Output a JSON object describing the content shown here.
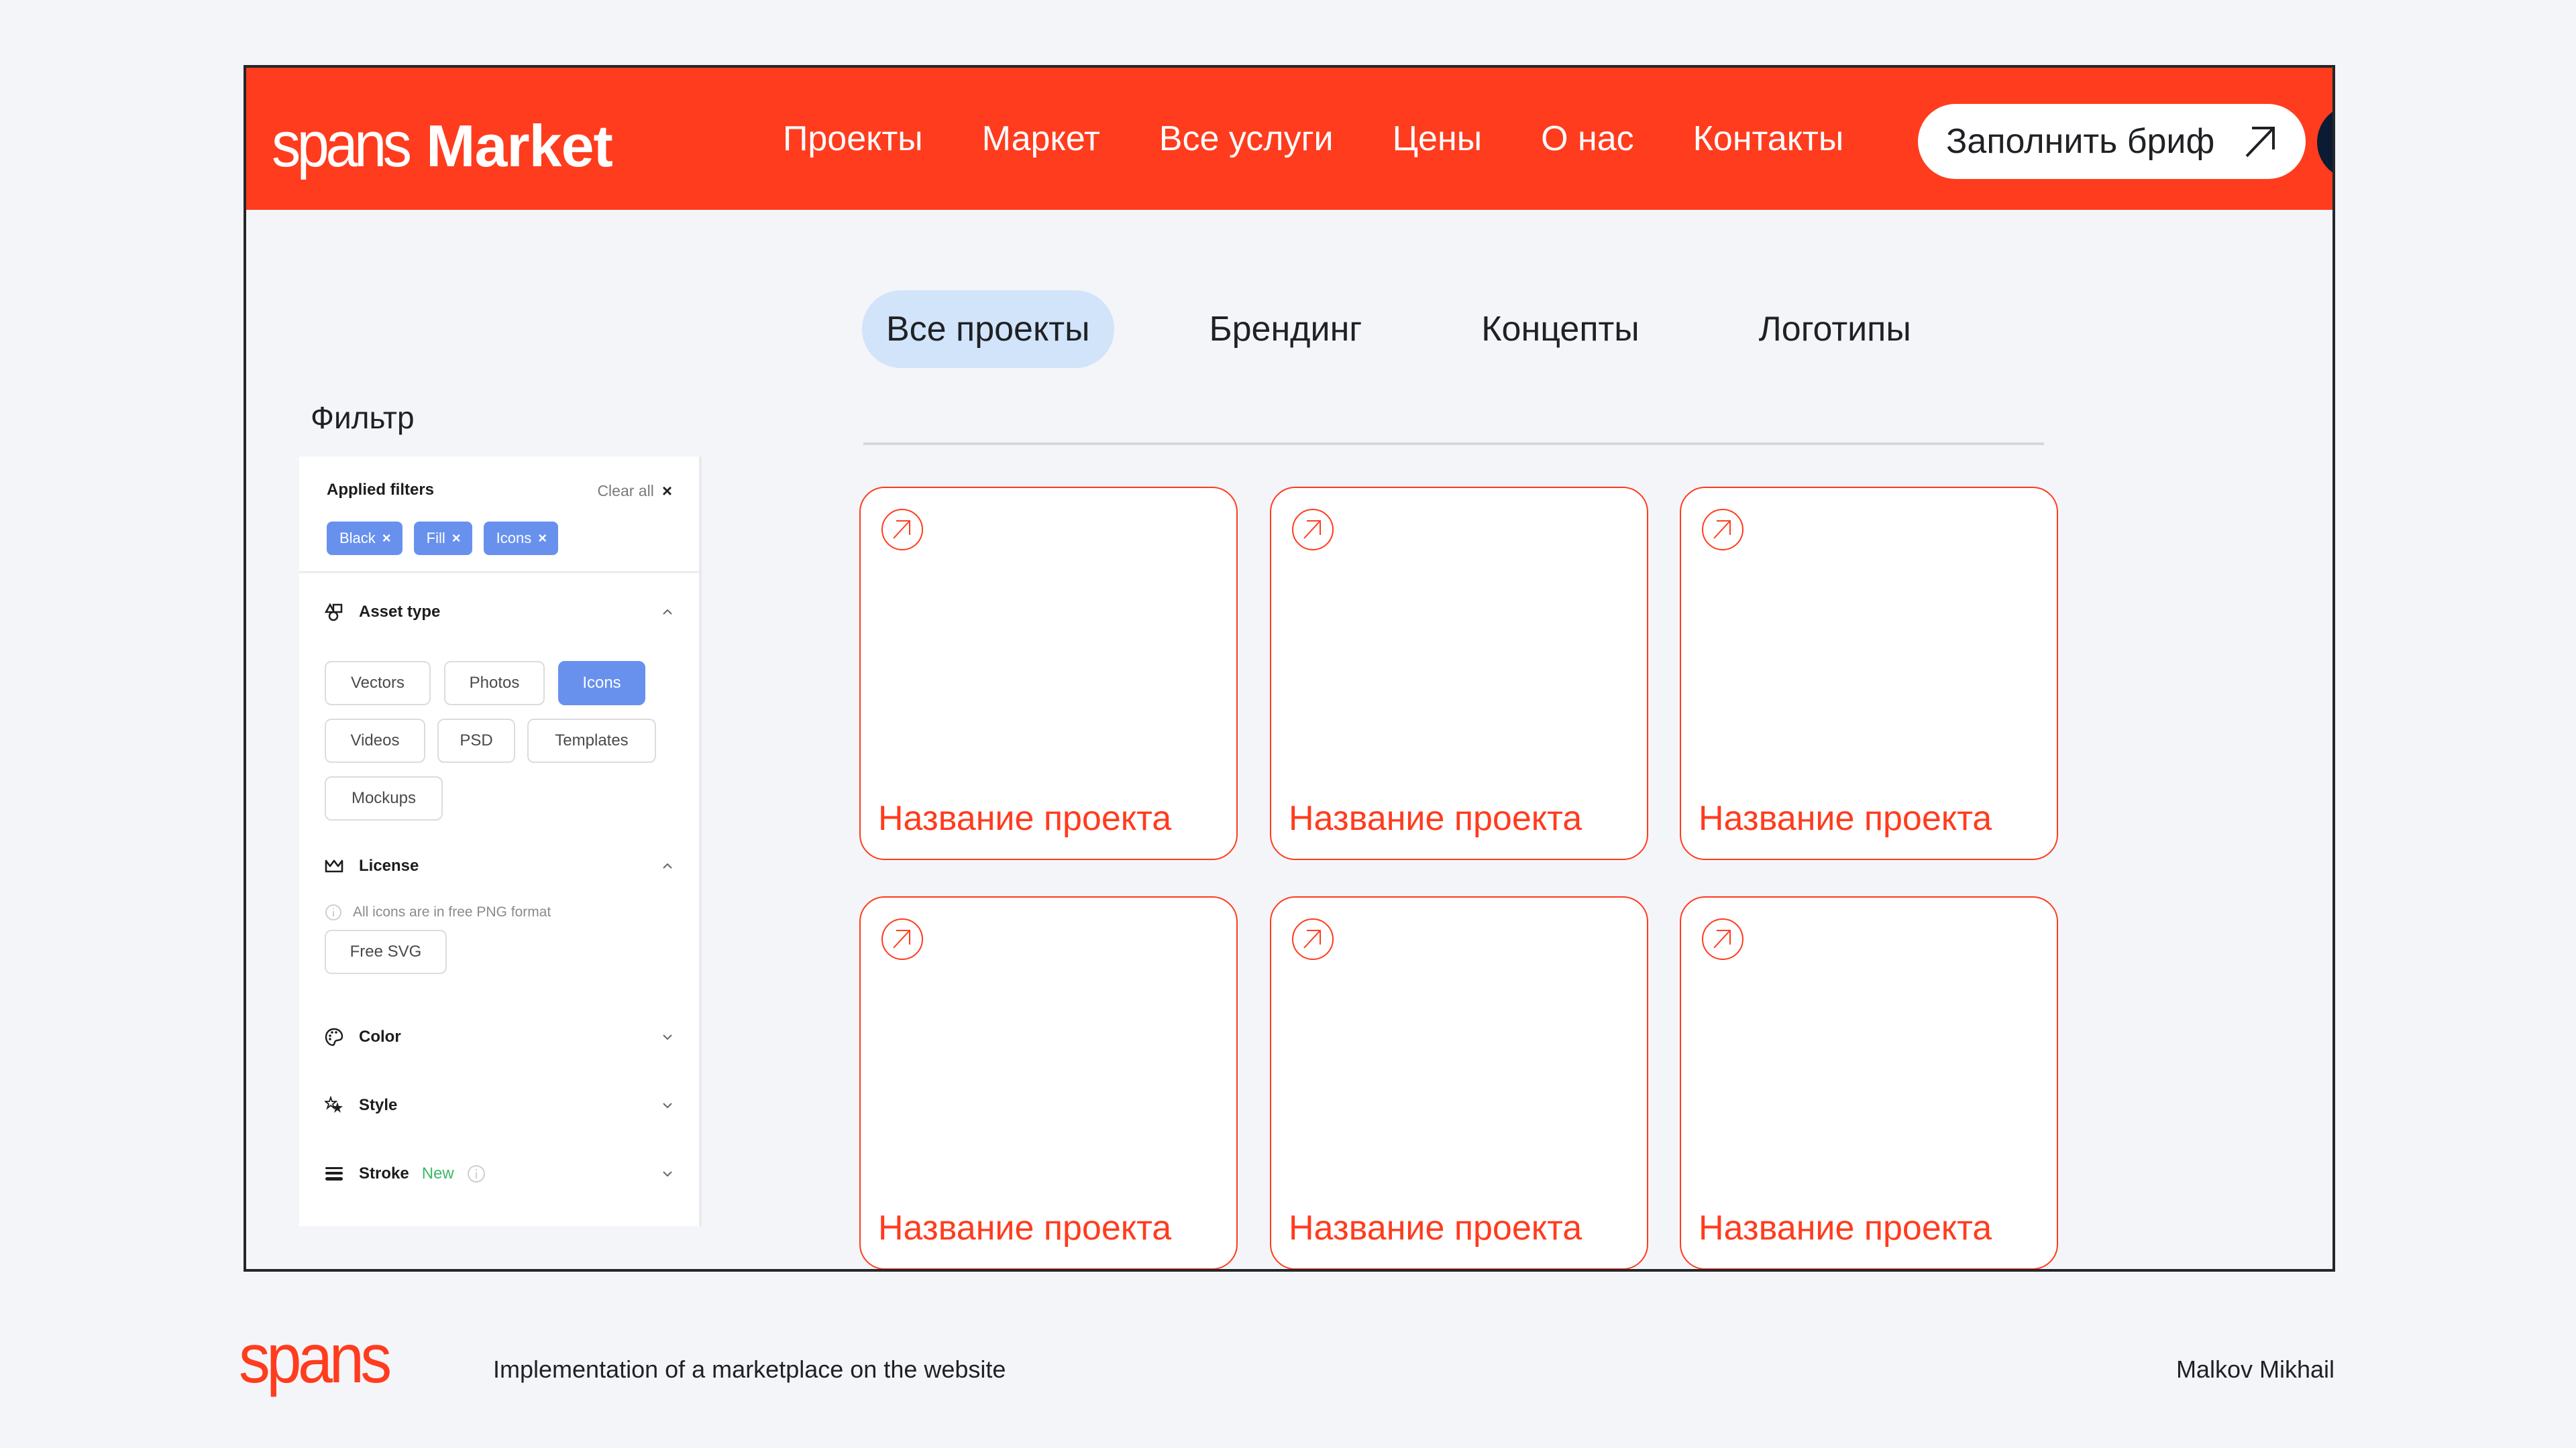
{
  "header": {
    "logo_word": "spans",
    "logo_product": "Market",
    "nav": [
      "Проекты",
      "Маркет",
      "Все услуги",
      "Цены",
      "О нас",
      "Контакты"
    ],
    "cta_label": "Заполнить бриф",
    "cta_icon": "arrow-up-right-icon"
  },
  "tabs": [
    {
      "label": "Все проекты",
      "active": true
    },
    {
      "label": "Брендинг",
      "active": false
    },
    {
      "label": "Концепты",
      "active": false
    },
    {
      "label": "Логотипы",
      "active": false
    }
  ],
  "filter": {
    "title": "Фильтр",
    "applied": {
      "title": "Applied filters",
      "clear_all": "Clear all",
      "chips": [
        "Black",
        "Fill",
        "Icons"
      ]
    },
    "sections": {
      "asset_type": {
        "title": "Asset type",
        "expanded": true,
        "options": [
          "Vectors",
          "Photos",
          "Icons",
          "Videos",
          "PSD",
          "Templates",
          "Mockups"
        ],
        "selected": "Icons"
      },
      "license": {
        "title": "License",
        "expanded": true,
        "note": "All icons are in free PNG format",
        "options": [
          "Free SVG"
        ]
      },
      "color": {
        "title": "Color",
        "expanded": false
      },
      "style": {
        "title": "Style",
        "expanded": false
      },
      "stroke": {
        "title": "Stroke",
        "badge": "New",
        "expanded": false
      }
    }
  },
  "projects": [
    {
      "name": "Название проекта"
    },
    {
      "name": "Название проекта"
    },
    {
      "name": "Название проекта"
    },
    {
      "name": "Название проекта"
    },
    {
      "name": "Название проекта"
    },
    {
      "name": "Название проекта"
    }
  ],
  "footer": {
    "logo": "spans",
    "caption": "Implementation of a marketplace on the website",
    "author": "Malkov Mikhail"
  },
  "colors": {
    "brand": "#ff3c1e",
    "chip": "#6891ee",
    "tab_active": "#d1e4f9",
    "badge_new": "#3db86a",
    "background": "#f4f5f9",
    "dark_accent": "#0b1b33"
  }
}
